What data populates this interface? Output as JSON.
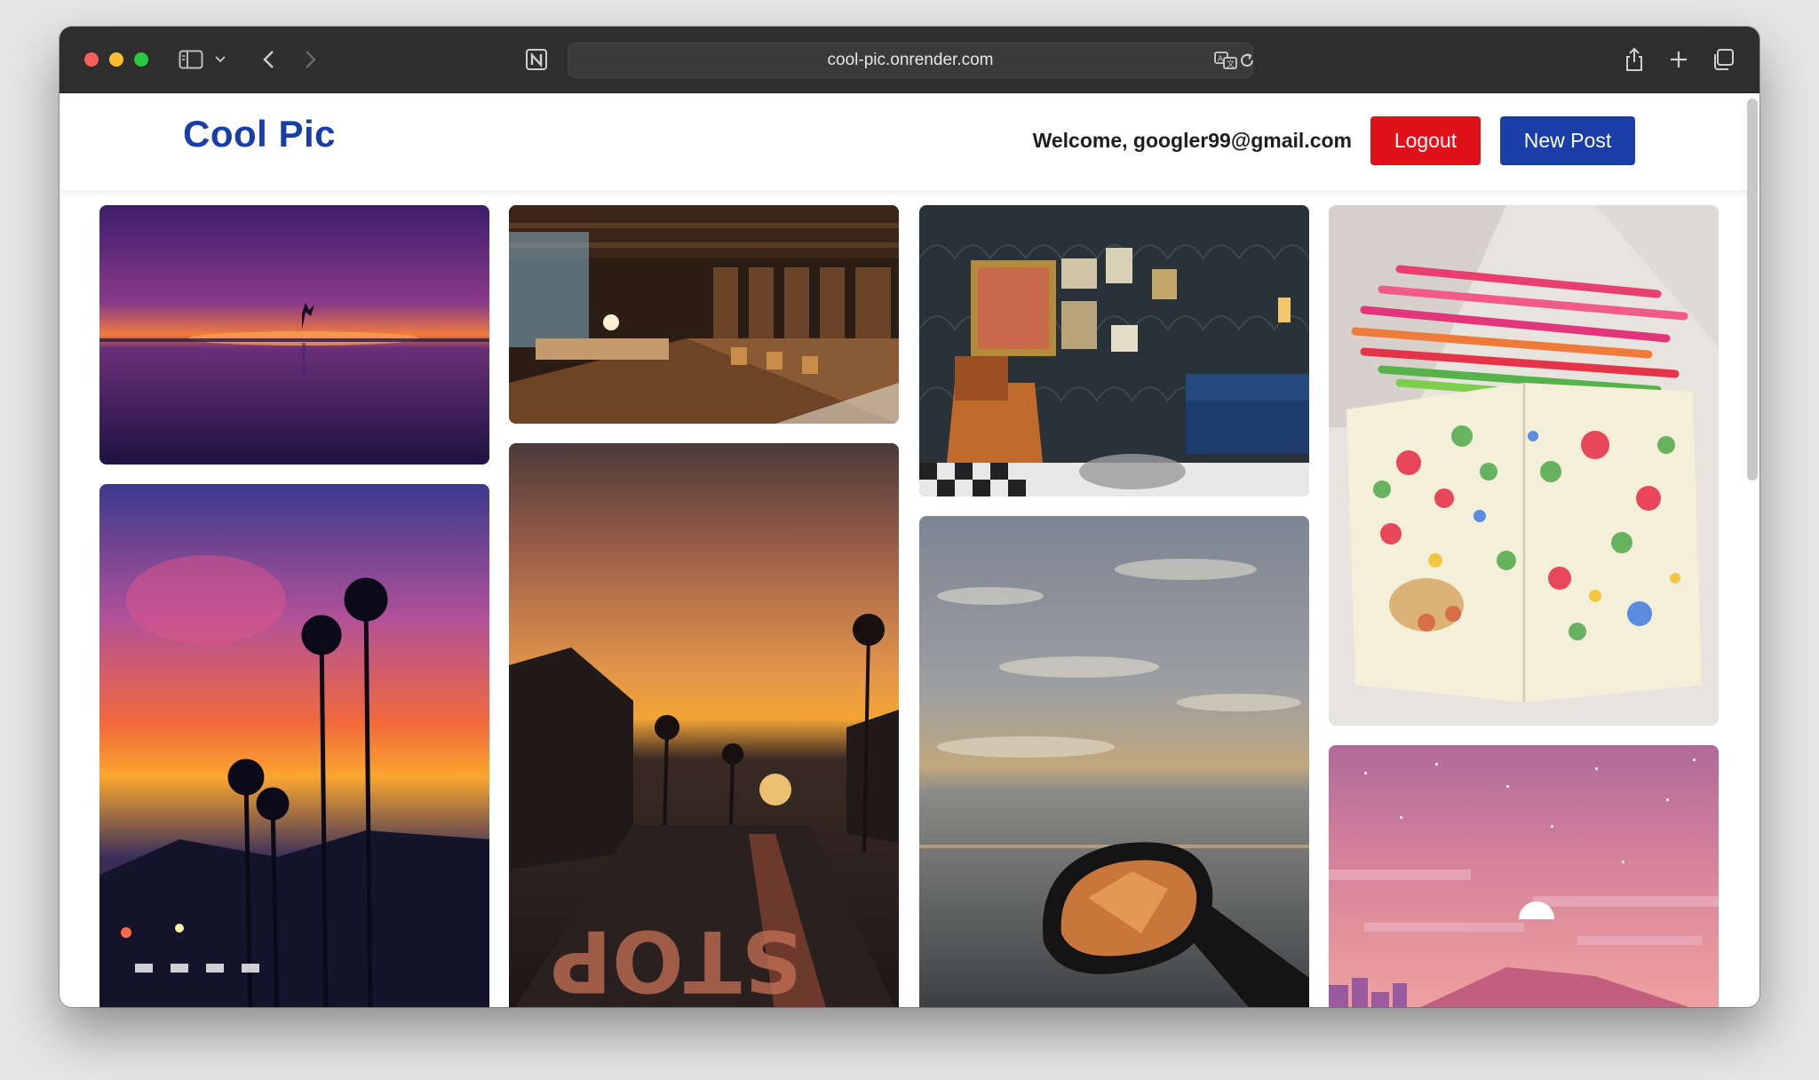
{
  "browser": {
    "url": "cool-pic.onrender.com",
    "icons": [
      "sidebar-icon",
      "chevron-down-icon",
      "back-icon",
      "forward-icon",
      "notion-icon",
      "translate-icon",
      "reload-icon",
      "share-icon",
      "new-tab-icon",
      "tab-overview-icon"
    ]
  },
  "header": {
    "brand": "Cool Pic",
    "welcome": "Welcome, googler99@gmail.com",
    "logout_label": "Logout",
    "new_post_label": "New Post"
  },
  "colors": {
    "brand": "#1a3ea8",
    "logout": "#e01119",
    "new_post": "#1a3ea8"
  },
  "gallery": {
    "photos": [
      "purple-sunset-beach-dancer",
      "library-reading-room",
      "lounge-with-gallery-wall",
      "colored-pencils-sketchbook",
      "palm-trees-sunset-street",
      "stop-street-sunset",
      "car-mirror-sea-sunset",
      "pixel-art-pink-sky"
    ]
  }
}
